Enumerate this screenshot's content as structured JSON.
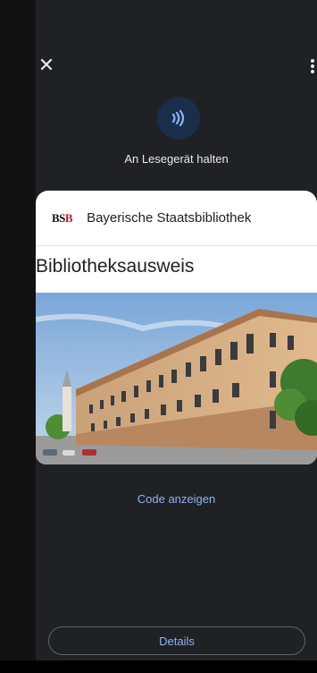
{
  "top_bar": {
    "close_icon": "close-icon",
    "menu_icon": "more-vert-icon"
  },
  "nfc": {
    "icon": "contactless-icon",
    "label": "An Lesegerät halten"
  },
  "card": {
    "issuer_logo": {
      "prefix": "BS",
      "suffix": "B"
    },
    "issuer_name": "Bayerische Staatsbibliothek",
    "title": "Bibliotheksausweis",
    "image": "library-building-photo"
  },
  "actions": {
    "show_code": "Code anzeigen",
    "details": "Details"
  },
  "colors": {
    "accent": "#8ab4f8",
    "background": "#202124",
    "card": "#ffffff",
    "logo_red": "#c8102e"
  }
}
